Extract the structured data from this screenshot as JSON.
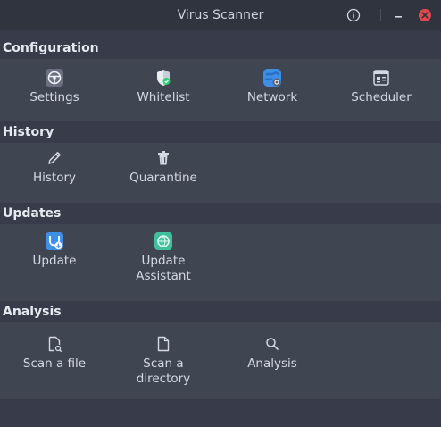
{
  "window": {
    "title": "Virus Scanner"
  },
  "titlebar": {
    "info_icon": "info-circle-icon",
    "minimize_icon": "minimize-icon",
    "close_icon": "close-icon",
    "close_color": "#e0484e"
  },
  "sections": {
    "configuration": {
      "title": "Configuration",
      "items": [
        {
          "label": "Settings",
          "icon": "steering-wheel-icon"
        },
        {
          "label": "Whitelist",
          "icon": "shield-check-icon"
        },
        {
          "label": "Network",
          "icon": "globe-network-icon"
        },
        {
          "label": "Scheduler",
          "icon": "calendar-icon"
        }
      ]
    },
    "history": {
      "title": "History",
      "items": [
        {
          "label": "History",
          "icon": "pencil-icon"
        },
        {
          "label": "Quarantine",
          "icon": "trash-icon"
        }
      ]
    },
    "updates": {
      "title": "Updates",
      "items": [
        {
          "label": "Update",
          "icon": "update-download-icon"
        },
        {
          "label": "Update\nAssistant",
          "icon": "update-assistant-icon"
        }
      ]
    },
    "analysis": {
      "title": "Analysis",
      "items": [
        {
          "label": "Scan a file",
          "icon": "file-scan-icon"
        },
        {
          "label": "Scan a\ndirectory",
          "icon": "document-icon"
        },
        {
          "label": "Analysis",
          "icon": "magnifier-icon"
        }
      ]
    }
  },
  "colors": {
    "background": "#383c4a",
    "section_body": "#404552",
    "titlebar": "#2f343f",
    "accent_blue": "#3d8fe8",
    "accent_green": "#3fc09a"
  }
}
